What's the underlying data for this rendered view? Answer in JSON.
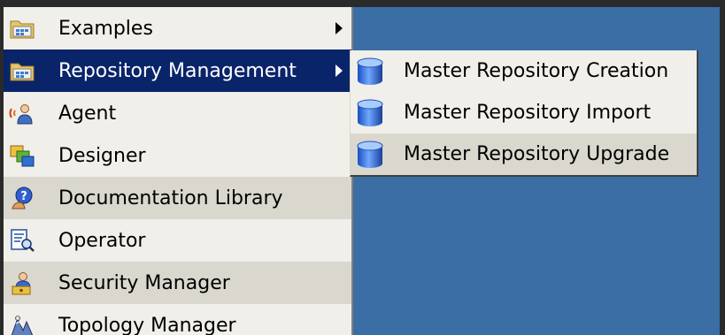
{
  "main_menu": {
    "items": [
      {
        "label": "Examples",
        "icon": "folder-icon",
        "has_submenu": true,
        "state": "normal"
      },
      {
        "label": "Repository Management",
        "icon": "folder-icon",
        "has_submenu": true,
        "state": "selected"
      },
      {
        "label": "Agent",
        "icon": "agent-icon",
        "has_submenu": false,
        "state": "normal"
      },
      {
        "label": "Designer",
        "icon": "designer-icon",
        "has_submenu": false,
        "state": "normal"
      },
      {
        "label": "Documentation Library",
        "icon": "help-icon",
        "has_submenu": false,
        "state": "hover"
      },
      {
        "label": "Operator",
        "icon": "operator-icon",
        "has_submenu": false,
        "state": "normal"
      },
      {
        "label": "Security Manager",
        "icon": "security-icon",
        "has_submenu": false,
        "state": "hover"
      },
      {
        "label": "Topology Manager",
        "icon": "topology-icon",
        "has_submenu": false,
        "state": "normal"
      }
    ]
  },
  "sub_menu": {
    "items": [
      {
        "label": "Master Repository Creation",
        "icon": "database-icon",
        "state": "normal"
      },
      {
        "label": "Master Repository Import",
        "icon": "database-icon",
        "state": "normal"
      },
      {
        "label": "Master Repository Upgrade",
        "icon": "database-icon",
        "state": "hover"
      }
    ]
  },
  "colors": {
    "desktop": "#3a6ea5",
    "menu_bg": "#f0efe9",
    "selected_bg": "#0a246a",
    "hover_bg": "#dad7ce"
  }
}
